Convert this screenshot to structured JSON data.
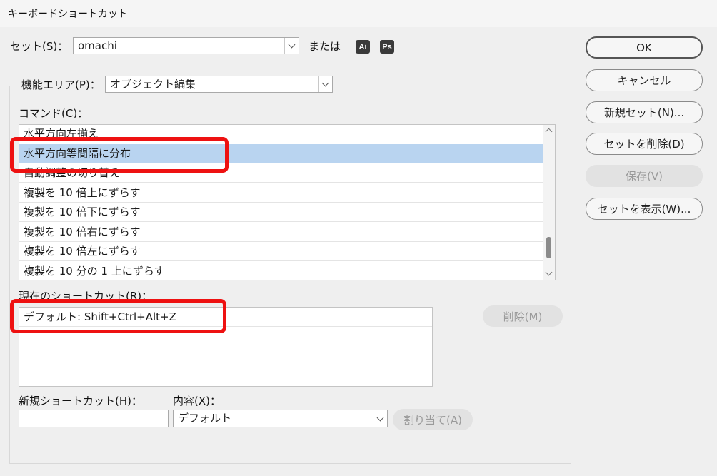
{
  "window": {
    "title": "キーボードショートカット"
  },
  "set_row": {
    "label": "セット(S)：",
    "value": "omachi",
    "or_label": "または",
    "icons": [
      {
        "name": "illustrator-icon",
        "text": "Ai"
      },
      {
        "name": "photoshop-icon",
        "text": "Ps"
      }
    ]
  },
  "area_row": {
    "label": "機能エリア(P)：",
    "value": "オブジェクト編集"
  },
  "commands": {
    "label": "コマンド(C)：",
    "items": [
      "水平方向左揃え",
      "水平方向等間隔に分布",
      "自動調整の切り替え",
      "複製を 10 倍上にずらす",
      "複製を 10 倍下にずらす",
      "複製を 10 倍右にずらす",
      "複製を 10 倍左にずらす",
      "複製を 10 分の 1 上にずらす"
    ],
    "selected_index": 1
  },
  "current_shortcut": {
    "label": "現在のショートカット(R)：",
    "items": [
      "デフォルト: Shift+Ctrl+Alt+Z"
    ],
    "delete_button": "削除(M)"
  },
  "new_shortcut": {
    "label": "新規ショートカット(H)：",
    "value": "",
    "content_label": "内容(X)：",
    "content_value": "デフォルト",
    "assign_button": "割り当て(A)"
  },
  "buttons": {
    "ok": "OK",
    "cancel": "キャンセル",
    "new_set": "新規セット(N)...",
    "delete_set": "セットを削除(D)",
    "save": "保存(V)",
    "show_set": "セットを表示(W)..."
  }
}
